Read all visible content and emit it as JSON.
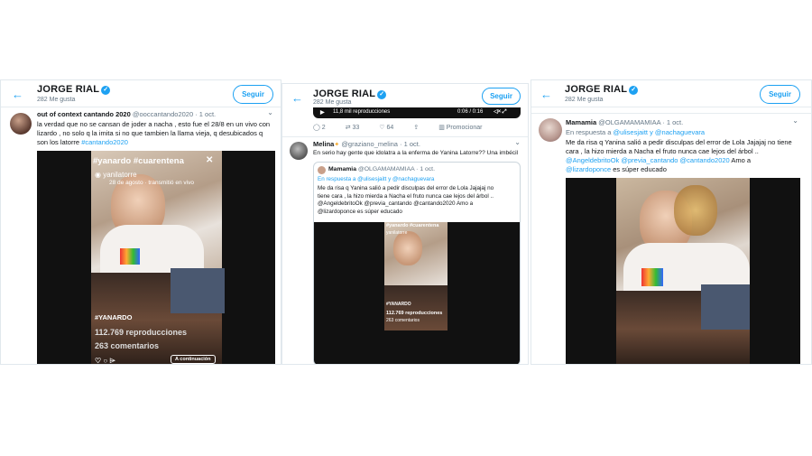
{
  "panels": [
    {
      "header": {
        "account": "JORGE RIAL",
        "likes": "282 Me gusta",
        "follow": "Seguir"
      },
      "tweet": {
        "name": "out of context cantando 2020",
        "handle": "@ooccantando2020 · 1 oct.",
        "lines": [
          "la verdad que no se cansan de joder a nacha , esto fue el 28/8 en un vivo con",
          "lizardo , no solo q la imita si no que tambien la llama vieja, q desubicados q",
          "son los latorre"
        ],
        "hashtag": "#cantando2020"
      },
      "video": {
        "tags": "#yanardo #cuarentena",
        "user": "yanilatorre",
        "date": "28 de agosto · transmitió en vivo",
        "tag2": "#YANARDO",
        "views": "112.769 reproducciones",
        "comments": "263 comentarios",
        "more": "A continuación"
      }
    },
    {
      "header": {
        "account": "JORGE RIAL",
        "likes": "282 Me gusta",
        "follow": "Seguir"
      },
      "video_top": {
        "views": "11,8 mil reproducciones",
        "time": "0:06 / 0:16"
      },
      "actions": {
        "replies": "2",
        "retweets": "33",
        "likes": "64",
        "promote": "Promocionar"
      },
      "tweet": {
        "name": "Melina",
        "handle": "@graziano_melina · 1 oct.",
        "text": "En serio hay gente que idolatra a la enferma de Yanina Latorre?? Una imbécil"
      },
      "quote": {
        "name": "Mamamia",
        "handle": "@OLGAMAMAMIAA · 1 oct.",
        "reply_to": "En respuesta a @ulisesjaitt y @nachaguevara",
        "lines": [
          "Me da risa q Yanina salió a pedir disculpas del  error  de Lola Jajajaj no",
          "tiene cara , la hizo mierda a Nacha el fruto nunca cae lejos del árbol ..",
          "@AngeldebritoOk @previa_cantando @cantando2020 Amo a",
          "@lizardoponce es súper educado"
        ]
      },
      "video": {
        "tags": "#yanardo #cuarentena",
        "user": "yanilatorre",
        "tag2": "#YANARDO",
        "views": "112.769 reproducciones",
        "comments": "263 comentarios"
      }
    },
    {
      "header": {
        "account": "JORGE RIAL",
        "likes": "282 Me gusta",
        "follow": "Seguir"
      },
      "tweet": {
        "name": "Mamamia",
        "handle": "@OLGAMAMAMIAA · 1 oct.",
        "reply_prefix": "En respuesta a",
        "reply_users": "@ulisesjaitt y @nachaguevara",
        "lines": [
          "Me da risa q Yanina salió a pedir disculpas del  error  de Lola Jajajaj no tiene",
          "cara , la hizo mierda a Nacha el fruto nunca cae lejos del árbol .."
        ],
        "mentions": "@AngeldebritoOk @previa_cantando @cantando2020",
        "amo": "Amo a",
        "last_mention": "@lizardoponce",
        "last_text": "es súper educado"
      }
    }
  ]
}
